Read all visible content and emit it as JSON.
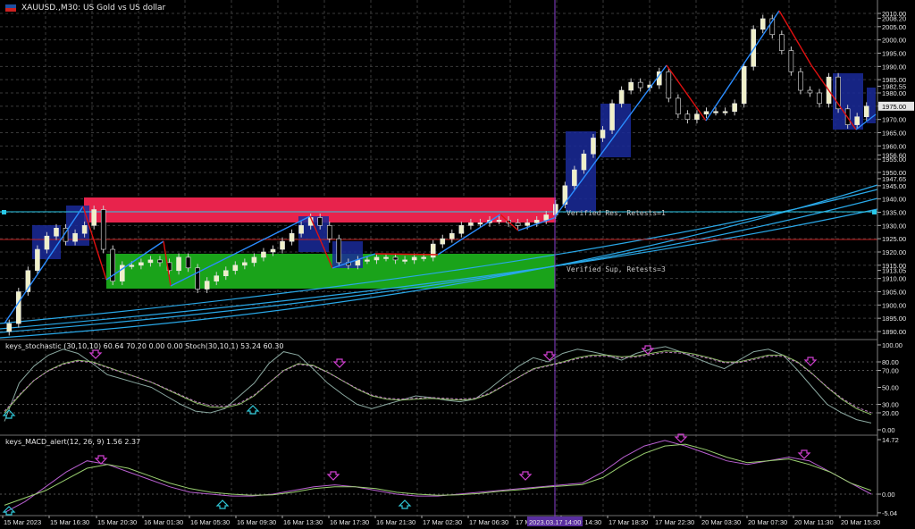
{
  "title": {
    "text": "XAUUSD.,M30:  US Gold vs US dollar"
  },
  "panes": {
    "stoch_label": "keys_stochastic (30,10,10) 60.64 70.20 0.00 0.00 Stoch(30,10,1) 53.24 60.30",
    "macd_label": "keys_MACD_alert(12, 26, 9) 1.56 2.37"
  },
  "zones": {
    "res_label": "Verified Res, Retests=1",
    "sup_label": "Verified Sup, Retests=3"
  },
  "price_axis": {
    "labels": [
      "2010.00",
      "2008.20",
      "2005.00",
      "2000.00",
      "1995.00",
      "1990.00",
      "1985.00",
      "1982.55",
      "1980.00",
      "1975.00",
      "1970.00",
      "1965.00",
      "1960.00",
      "1956.60",
      "1955.00",
      "1950.00",
      "1947.65",
      "1945.00",
      "1940.00",
      "1935.00",
      "1930.00",
      "1925.00",
      "1920.00",
      "1915.00",
      "1913.05",
      "1910.00",
      "1905.00",
      "1900.00",
      "1895.00",
      "1890.00"
    ],
    "current_price": "1975.00"
  },
  "stoch_axis": [
    "100.00",
    "80.00",
    "70.00",
    "50.00",
    "30.00",
    "20.00",
    "0.00"
  ],
  "macd_axis": [
    "14.72",
    "0.00",
    "-5.04"
  ],
  "time_axis": {
    "labels": [
      "15 Mar 2023",
      "15 Mar 16:30",
      "15 Mar 20:30",
      "16 Mar 01:30",
      "16 Mar 05:30",
      "16 Mar 09:30",
      "16 Mar 13:30",
      "16 Mar 17:30",
      "16 Mar 21:30",
      "17 Mar 02:30",
      "17 Mar 06:30",
      "17 M",
      "17 Mar 14:30",
      "17 Mar 18:30",
      "17 Mar 22:30",
      "20 Mar 03:30",
      "20 Mar 07:30",
      "20 Mar 11:30",
      "20 Mar 15:30"
    ],
    "cursor_label": "2023.03.17 14:00"
  },
  "colors": {
    "background": "#000000",
    "bull": "#f0f0c8",
    "bear": "#ffffff",
    "zigzag_up": "#2a8cff",
    "zigzag_down": "#e01010",
    "res_zone": "#e8234c",
    "sup_zone": "#1aa31a",
    "ma": "#29a8e8",
    "vline": "#8a3fd0",
    "stoch_main": "#8aa8a0",
    "stoch_signal": "#8fbf68",
    "macd_main": "#b85fd0",
    "macd_signal": "#9ad070"
  },
  "chart_data": {
    "type": "line",
    "title": "XAUUSD.,M30:  US Gold vs US dollar",
    "xlabel": "",
    "ylabel": "",
    "ylim": [
      1887,
      2012
    ],
    "close_approx": [
      1893,
      1905,
      1913,
      1921,
      1926,
      1929,
      1924,
      1927,
      1930,
      1936,
      1921,
      1909,
      1915,
      1915,
      1916,
      1917,
      1916,
      1913,
      1918,
      1914,
      1906,
      1909,
      1911,
      1913,
      1915,
      1916,
      1918,
      1920,
      1921,
      1924,
      1927,
      1930,
      1933,
      1930,
      1925,
      1916,
      1915,
      1917,
      1917,
      1918,
      1918,
      1917,
      1917,
      1918,
      1918,
      1923,
      1925,
      1927,
      1930,
      1931,
      1931,
      1932,
      1932,
      1931,
      1930,
      1931,
      1932,
      1934,
      1938,
      1945,
      1951,
      1957,
      1963,
      1966,
      1976,
      1981,
      1984,
      1982,
      1983,
      1988,
      1978,
      1972,
      1970,
      1972,
      1973,
      1973,
      1973,
      1976,
      1990,
      2004,
      2008,
      2002,
      1996,
      1988,
      1981,
      1980,
      1976,
      1986,
      1974,
      1968,
      1971,
      1975
    ]
  }
}
